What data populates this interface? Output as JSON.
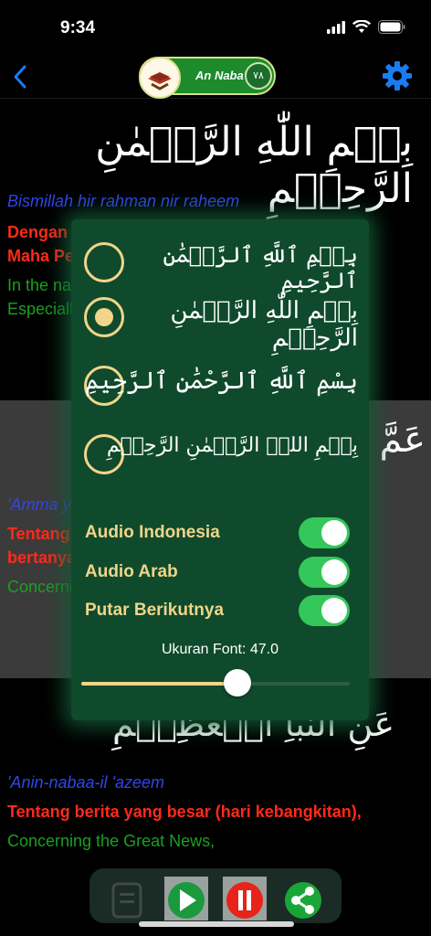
{
  "status_bar": {
    "time": "9:34"
  },
  "nav": {
    "title": "An Naba'",
    "badge": "٧٨"
  },
  "bismillah": {
    "arabic": "بِسۡمِ اللّٰهِ الرَّحۡمٰنِ الرَّحِيۡمِ",
    "transliteration": "Bismillah hir rahman nir raheem",
    "indonesian_line1": "Dengan nama Allah Yang Maha Pengasih,",
    "indonesian_line2": "Maha Penyayang.",
    "english_line1": "In the name of Allah, the Entirely Merciful, the",
    "english_line2": "Especially Merciful."
  },
  "verses": [
    {
      "arabic": "عَمَّ يَتَسَآءَلُونَ",
      "transliteration": "'Amma yatasaa-aloon",
      "indonesian_line1": "Tentang apakah mereka saling",
      "indonesian_line2": "bertanya-tanya?",
      "english": "Concerning what are they asking one another?"
    },
    {
      "arabic": "عَنِ النَّبَاِ الۡعَظِيۡمِ",
      "transliteration": "'Anin-nabaa-il 'azeem",
      "indonesian": "Tentang berita yang besar (hari kebangkitan),",
      "english": "Concerning the Great News,"
    }
  ],
  "settings": {
    "script_options": [
      {
        "arabic": "بِسۡمِ ٱللَّهِ ٱلرَّحۡمَٰنِ ٱلرَّحِيمِ",
        "selected": false
      },
      {
        "arabic": "بِسۡمِ اللّٰهِ الرَّحۡمٰنِ الرَّحِيۡمِ",
        "selected": true
      },
      {
        "arabic": "بِسْمِ ٱللَّهِ ٱلرَّحْمَٰنِ ٱلرَّحِيمِ",
        "selected": false
      },
      {
        "arabic": "بِسۡمِ اللہِ الرَّحۡمٰنِ الرَّحِیۡمِ",
        "selected": false
      }
    ],
    "toggles": [
      {
        "label": "Audio Indonesia",
        "on": true
      },
      {
        "label": "Audio Arab",
        "on": true
      },
      {
        "label": "Putar Berikutnya",
        "on": true
      }
    ],
    "font_size_label": "Ukuran Font: 47.0",
    "font_slider_fraction": 0.58
  },
  "colors": {
    "accent": "#1a7cf2",
    "translit": "#2f46e8",
    "indonesian": "#ff2a1a",
    "english": "#19a11d",
    "panel": "#0f4a2c",
    "gold": "#f1d58a"
  }
}
